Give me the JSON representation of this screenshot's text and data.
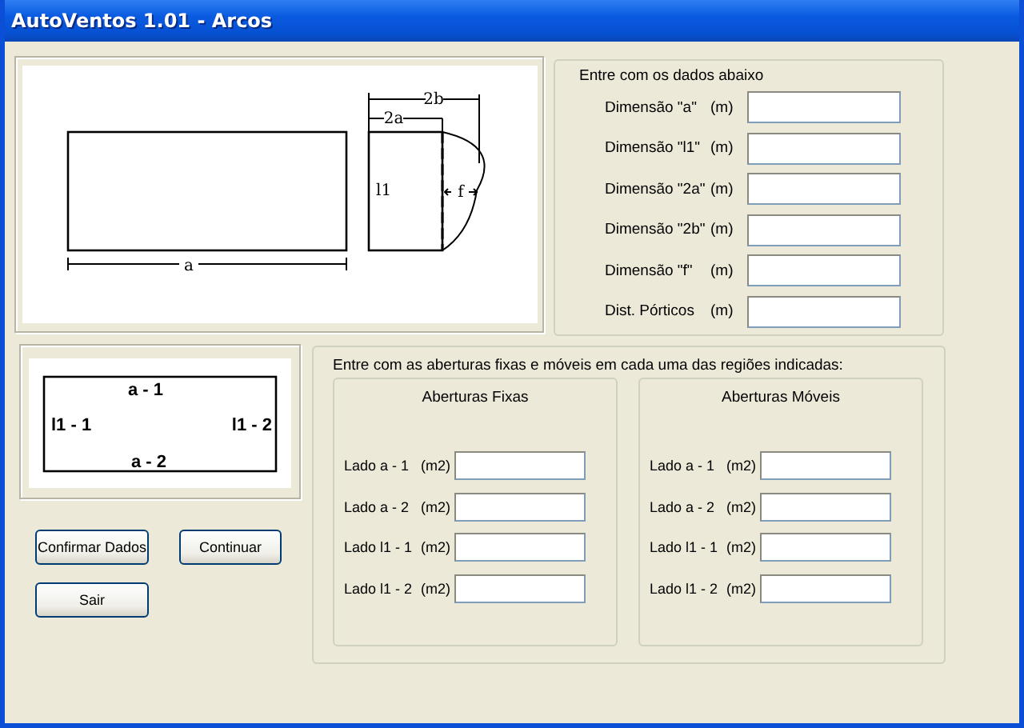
{
  "window": {
    "title": "AutoVentos 1.01 - Arcos"
  },
  "plan_diagram": {
    "labels": [
      "2b",
      "2a",
      "l1",
      "f",
      "a"
    ]
  },
  "dimensions": {
    "heading": "Entre com os dados abaixo",
    "rows": [
      {
        "label": "Dimensão \"a\"",
        "unit": "(m)"
      },
      {
        "label": "Dimensão \"l1\"",
        "unit": "(m)"
      },
      {
        "label": "Dimensão \"2a\"",
        "unit": "(m)"
      },
      {
        "label": "Dimensão \"2b\"",
        "unit": "(m)"
      },
      {
        "label": "Dimensão \"f\"",
        "unit": "(m)"
      },
      {
        "label": "Dist. Pórticos",
        "unit": "(m)"
      }
    ]
  },
  "region_diagram": {
    "labels": [
      "a - 1",
      "l1 - 1",
      "l1 - 2",
      "a - 2"
    ]
  },
  "buttons": [
    {
      "label": "Confirmar Dados"
    },
    {
      "label": "Continuar"
    },
    {
      "label": "Sair"
    }
  ],
  "openings": {
    "heading": "Entre com as aberturas fixas e móveis em cada uma das regiões indicadas:",
    "groups": [
      {
        "title": "Aberturas Fixas",
        "rows": [
          {
            "label": "Lado a - 1",
            "unit": "(m2)"
          },
          {
            "label": "Lado a - 2",
            "unit": "(m2)"
          },
          {
            "label": "Lado l1 - 1",
            "unit": "(m2)"
          },
          {
            "label": "Lado l1 - 2",
            "unit": "(m2)"
          }
        ]
      },
      {
        "title": "Aberturas Móveis",
        "rows": [
          {
            "label": "Lado a - 1",
            "unit": "(m2)"
          },
          {
            "label": "Lado a - 2",
            "unit": "(m2)"
          },
          {
            "label": "Lado l1 - 1",
            "unit": "(m2)"
          },
          {
            "label": "Lado l1 - 2",
            "unit": "(m2)"
          }
        ]
      }
    ]
  }
}
